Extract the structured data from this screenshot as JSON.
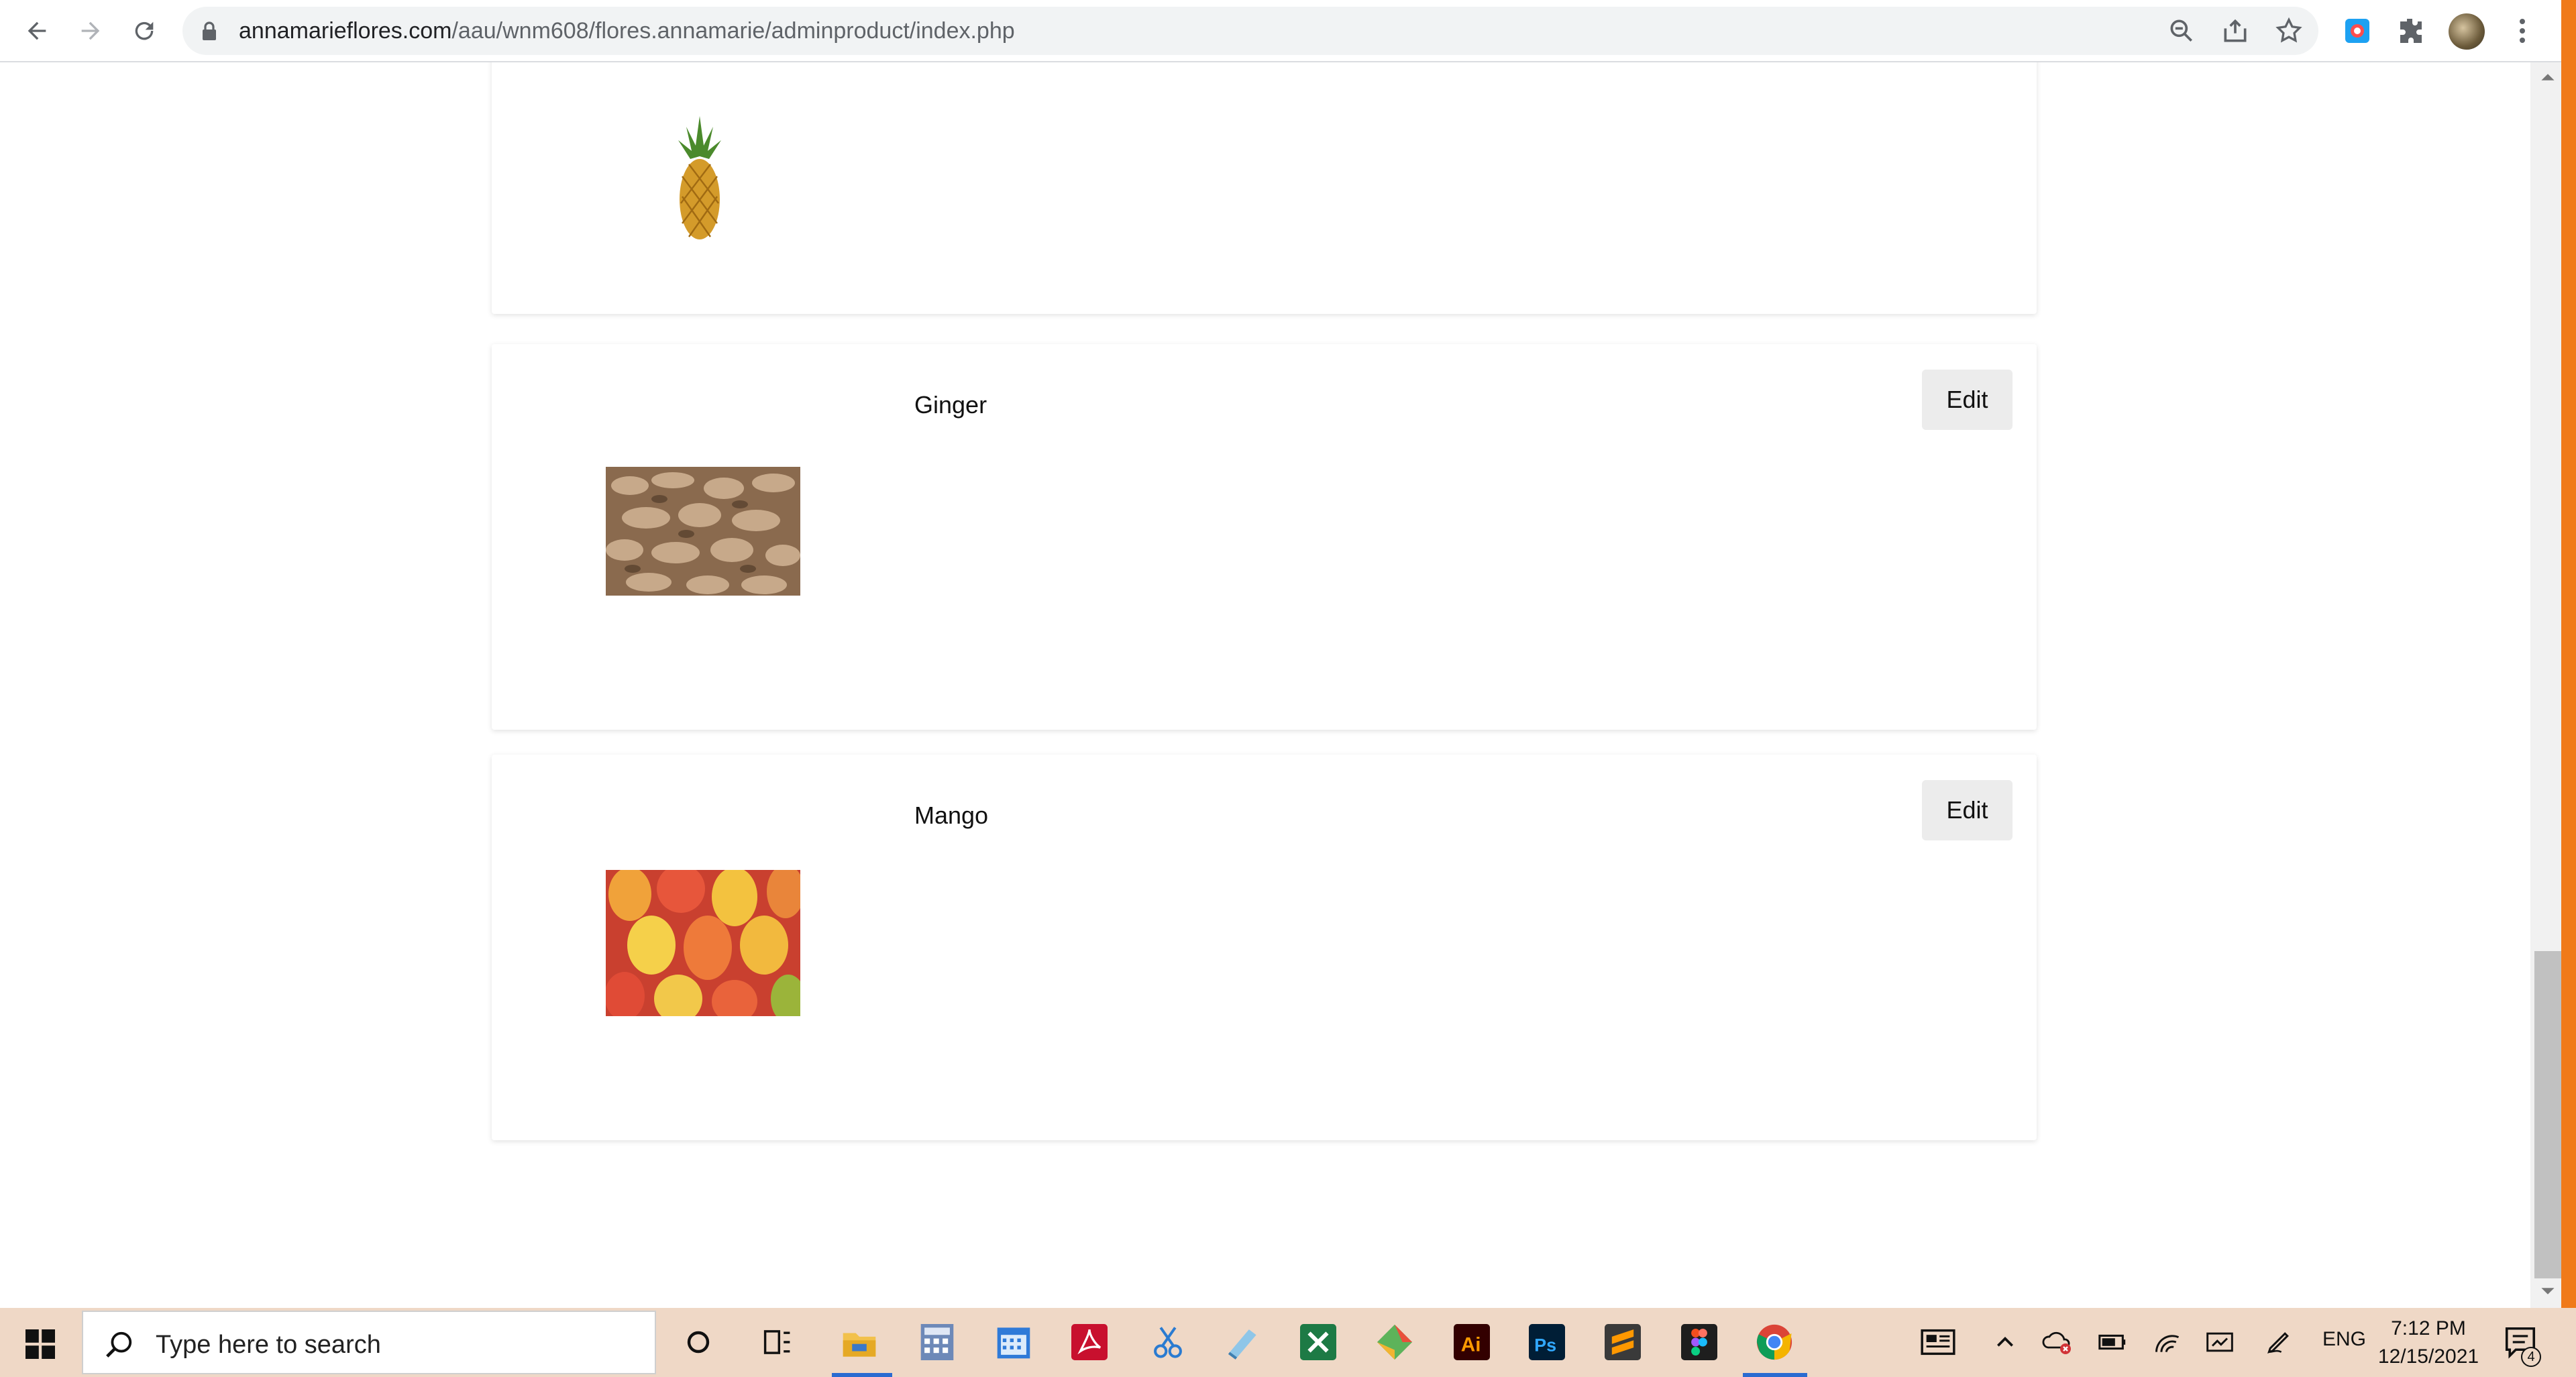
{
  "browser": {
    "url_domain": "annamarieflores.com",
    "url_path": "/aau/wnm608/flores.annamarie/adminproduct/index.php"
  },
  "products": [
    {
      "name": "",
      "image": "pineapple"
    },
    {
      "name": "Ginger",
      "edit_label": "Edit",
      "image": "ginger"
    },
    {
      "name": "Mango",
      "edit_label": "Edit",
      "image": "mango"
    }
  ],
  "taskbar": {
    "search_placeholder": "Type here to search",
    "language": "ENG",
    "time": "7:12 PM",
    "date": "12/15/2021",
    "notification_count": "4",
    "apps": [
      "cortana-icon",
      "task-view-icon",
      "file-explorer-icon",
      "calculator-icon",
      "calendar-icon",
      "acrobat-icon",
      "snip-icon",
      "notepad-icon",
      "excel-icon",
      "git-icon",
      "illustrator-icon",
      "photoshop-icon",
      "sublime-icon",
      "figma-icon",
      "chrome-icon"
    ]
  },
  "colors": {
    "accent": "#f07a1a",
    "taskbar": "#efd8c6",
    "edit_button_bg": "#ececec"
  }
}
